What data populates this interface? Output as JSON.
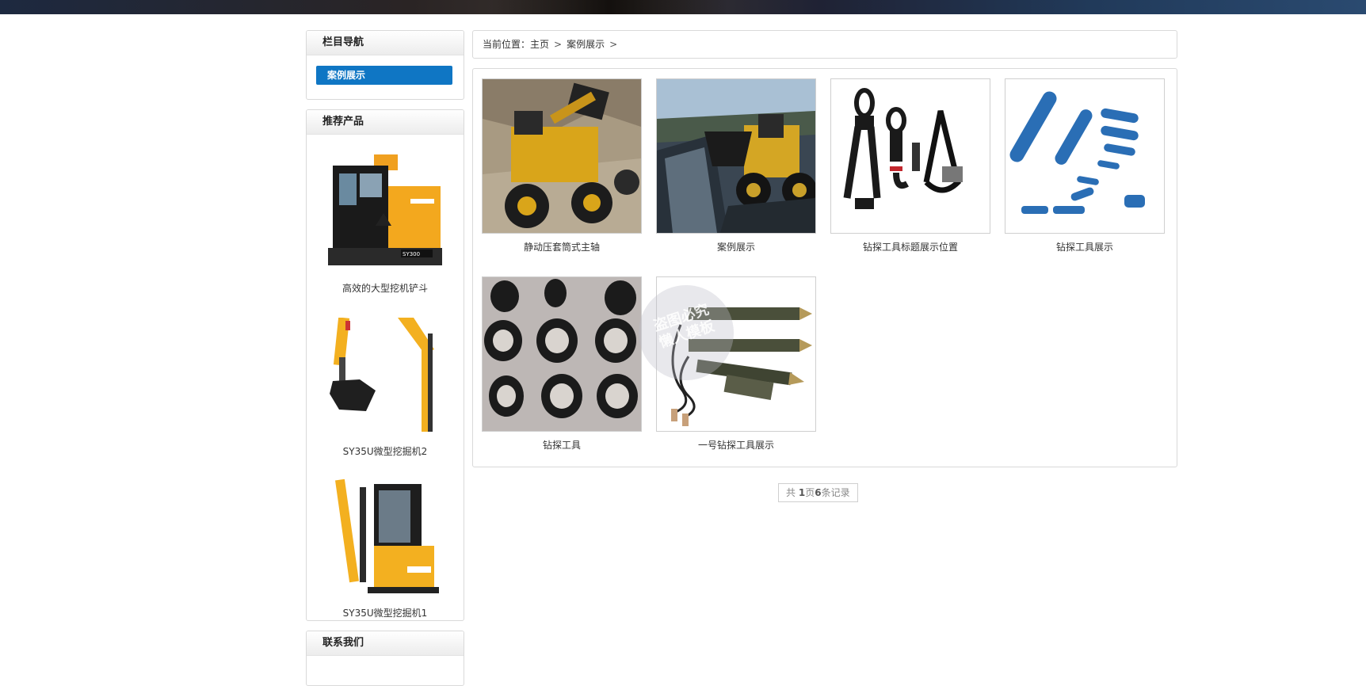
{
  "sidebar": {
    "nav_title": "栏目导航",
    "nav_active": "案例展示",
    "recommend_title": "推荐产品",
    "products": [
      {
        "name": "高效的大型挖机铲斗",
        "icon": "excavator-cab-icon"
      },
      {
        "name": "SY35U微型挖掘机2",
        "icon": "excavator-arm-icon"
      },
      {
        "name": "SY35U微型挖掘机1",
        "icon": "mini-excavator-icon"
      }
    ],
    "contact_title": "联系我们"
  },
  "breadcrumb": {
    "prefix": "当前位置：",
    "home": "主页",
    "sep": ">",
    "current": "案例展示"
  },
  "cases": [
    {
      "title": "静动压套筒式主轴",
      "icon": "wheel-loader-quarry-icon"
    },
    {
      "title": "案例展示",
      "icon": "wheel-loader-coal-icon"
    },
    {
      "title": "钻探工具标题展示位置",
      "icon": "lifting-hooks-icon"
    },
    {
      "title": "钻探工具展示",
      "icon": "blue-pins-icon"
    },
    {
      "title": "钻探工具",
      "icon": "drill-bits-icon"
    },
    {
      "title": "一号钻探工具展示",
      "icon": "probe-tools-icon"
    }
  ],
  "pager": {
    "pre": "共 ",
    "pages": "1",
    "mid": "页",
    "records": "6",
    "post": "条记录"
  },
  "watermark": {
    "line1": "盗图必究",
    "line2": "懒人模板"
  },
  "colors": {
    "accent": "#0f76c4",
    "border": "#d9d9d9"
  }
}
